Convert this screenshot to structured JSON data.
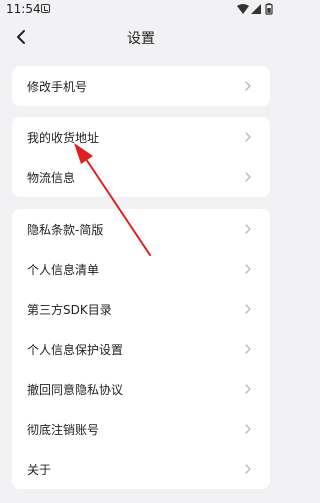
{
  "status_bar": {
    "time": "11:54"
  },
  "header": {
    "title": "设置"
  },
  "cards": [
    {
      "items": [
        {
          "label": "修改手机号"
        }
      ]
    },
    {
      "items": [
        {
          "label": "我的收货地址"
        },
        {
          "label": "物流信息"
        }
      ]
    },
    {
      "items": [
        {
          "label": "隐私条款-简版"
        },
        {
          "label": "个人信息清单"
        },
        {
          "label": "第三方SDK目录"
        },
        {
          "label": "个人信息保护设置"
        },
        {
          "label": "撤回同意隐私协议"
        },
        {
          "label": "彻底注销账号"
        },
        {
          "label": "关于"
        }
      ]
    }
  ],
  "icons": {
    "back": "chevron-left-icon",
    "row_arrow": "chevron-right-icon"
  },
  "colors": {
    "background": "#f2f2f4",
    "card": "#ffffff",
    "annotation_arrow": "#e02020"
  }
}
